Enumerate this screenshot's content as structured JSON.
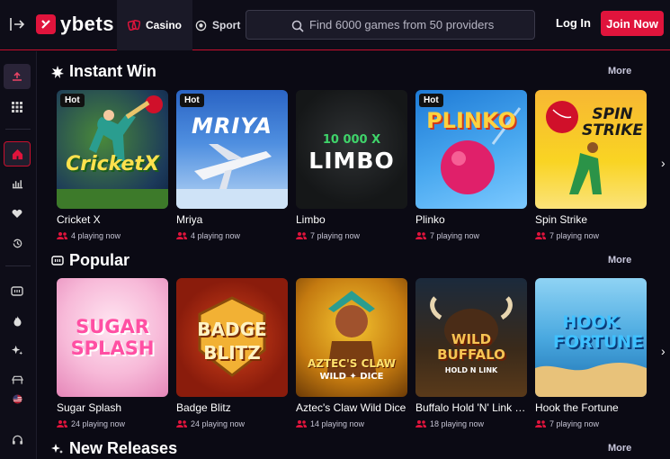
{
  "brand": {
    "name": "ybets",
    "accent": "#e0143c"
  },
  "nav": {
    "casino": "Casino",
    "sport": "Sport"
  },
  "search": {
    "placeholder": "Find 6000 games from 50 providers"
  },
  "auth": {
    "login": "Log In",
    "join": "Join Now"
  },
  "sidebar": {
    "icons": [
      "user-icon",
      "grid-icon",
      "home-icon",
      "stats-icon",
      "heart-icon",
      "history-icon",
      "slots-icon",
      "fire-icon",
      "sparkle-icon",
      "table-games-icon",
      "flag-icon",
      "support-icon"
    ]
  },
  "sections": [
    {
      "title": "Instant Win",
      "more": "More",
      "games": [
        {
          "name": "Cricket X",
          "playing": "4 playing now",
          "hot": "Hot",
          "art": "CricketX"
        },
        {
          "name": "Mriya",
          "playing": "4 playing now",
          "hot": "Hot",
          "art": "MRIYA"
        },
        {
          "name": "Limbo",
          "playing": "7 playing now",
          "hot": "",
          "art": "LIMBO",
          "art_sub": "10 000 X"
        },
        {
          "name": "Plinko",
          "playing": "7 playing now",
          "hot": "Hot",
          "art": "PLINKO"
        },
        {
          "name": "Spin Strike",
          "playing": "7 playing now",
          "hot": "",
          "art": "SPIN STRIKE"
        }
      ]
    },
    {
      "title": "Popular",
      "more": "More",
      "games": [
        {
          "name": "Sugar Splash",
          "playing": "24 playing now",
          "hot": "",
          "art": "SUGAR SPLASH"
        },
        {
          "name": "Badge Blitz",
          "playing": "24 playing now",
          "hot": "",
          "art": "BADGE BLITZ"
        },
        {
          "name": "Aztec's Claw Wild Dice",
          "playing": "14 playing now",
          "hot": "",
          "art": "AZTEC'S CLAW",
          "art_sub": "WILD ✦ DICE"
        },
        {
          "name": "Buffalo Hold 'N' Link …",
          "playing": "18 playing now",
          "hot": "",
          "art": "WILD BUFFALO",
          "art_sub": "HOLD N LINK"
        },
        {
          "name": "Hook the Fortune",
          "playing": "7 playing now",
          "hot": "",
          "art": "HOOK FORTUNE"
        }
      ]
    },
    {
      "title": "New Releases",
      "more": "More"
    }
  ]
}
